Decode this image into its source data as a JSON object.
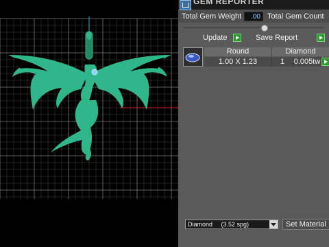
{
  "panel": {
    "title": "GEM REPORTER",
    "total_gem_weight_label": "Total Gem Weight",
    "total_gem_weight_value": ".00",
    "total_gem_count_label": "Total Gem Count",
    "update_label": "Update",
    "save_report_label": "Save Report",
    "table": {
      "headers": [
        "Round",
        "Diamond"
      ],
      "rows": [
        {
          "size": "1.00 X 1.23",
          "count": "1",
          "weight": "0.005tw"
        }
      ]
    },
    "material_select_value": "Diamond     (3.52 spg)",
    "set_material_label": "Set Material"
  },
  "colors": {
    "gem_green": "#2fb68a",
    "bail_green": "#1f8a63",
    "grid": "#8a8a8a",
    "axis_red": "#d42222",
    "axis_cyan": "#1fb7c7",
    "panel_bg": "#5a5a5a"
  },
  "icons": {
    "panel_icon": "gem-reporter-icon",
    "arrow": "green-play-arrow-icon",
    "dropdown": "chevron-down-icon"
  }
}
